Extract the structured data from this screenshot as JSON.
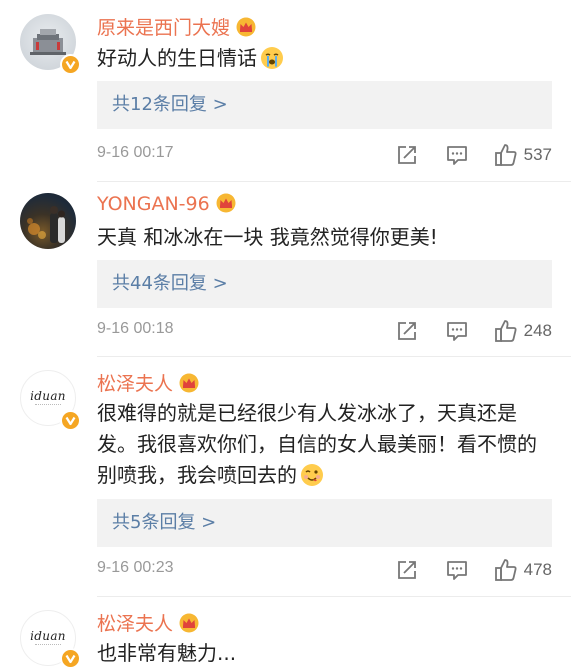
{
  "comments": [
    {
      "username": "原来是西门大嫂",
      "content": "好动人的生日情话",
      "emoji": "crying-face",
      "reply_text": "共12条回复 >",
      "timestamp": "9-16 00:17",
      "likes": "537"
    },
    {
      "username": "YONGAN-96",
      "content": "天真 和冰冰在一块 我竟然觉得你更美!",
      "reply_text": "共44条回复 >",
      "timestamp": "9-16 00:18",
      "likes": "248"
    },
    {
      "username": "松泽夫人",
      "content": "很难得的就是已经很少有人发冰冰了，天真还是发。我很喜欢你们，自信的女人最美丽！看不惯的别喷我，我会喷回去的",
      "emoji": "yum-face",
      "reply_text": "共5条回复 >",
      "timestamp": "9-16 00:23",
      "likes": "478"
    },
    {
      "username": "松泽夫人",
      "content": "也非常有魅力..."
    }
  ],
  "avatar_logo_text": "iduan",
  "colors": {
    "username": "#eb7350",
    "reply_link": "#5b7ea6",
    "reply_bg": "#f2f2f2",
    "meta": "#999999",
    "badge": "#f5a623"
  },
  "icons": {
    "verified_badge": "verified-v-icon",
    "vip_crown": "crown-icon",
    "share": "share-icon",
    "comment": "comment-icon",
    "like": "thumbs-up-icon"
  }
}
